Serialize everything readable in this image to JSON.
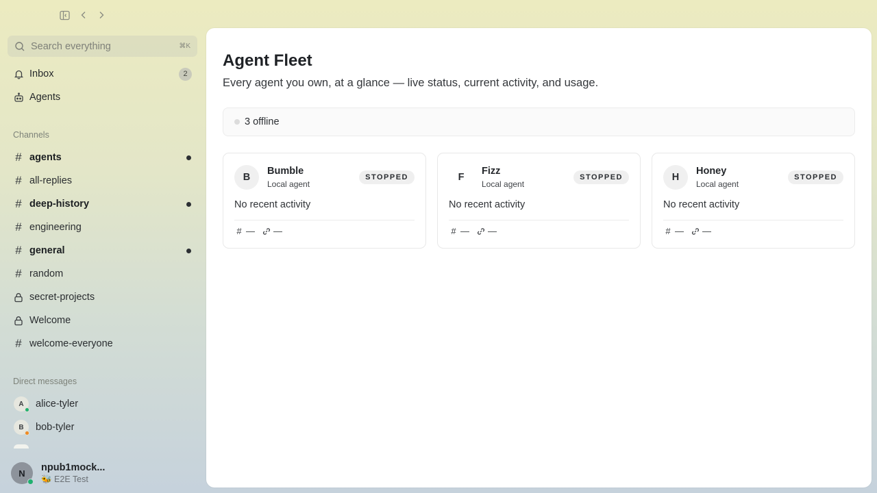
{
  "toolbar": {
    "icons": [
      "sidebar-toggle-icon",
      "back-arrow-icon",
      "forward-arrow-icon"
    ]
  },
  "sidebar": {
    "search": {
      "placeholder": "Search everything",
      "shortcut": "⌘K"
    },
    "nav": [
      {
        "label": "Inbox",
        "icon": "bell-icon",
        "badge": "2"
      },
      {
        "label": "Agents",
        "icon": "robot-icon"
      }
    ],
    "channels_label": "Channels",
    "channels": [
      {
        "label": "agents",
        "icon": "hash-icon",
        "unread": true
      },
      {
        "label": "all-replies",
        "icon": "hash-icon",
        "unread": false
      },
      {
        "label": "deep-history",
        "icon": "hash-icon",
        "unread": true
      },
      {
        "label": "engineering",
        "icon": "hash-icon",
        "unread": false
      },
      {
        "label": "general",
        "icon": "hash-icon",
        "unread": true
      },
      {
        "label": "random",
        "icon": "hash-icon",
        "unread": false
      },
      {
        "label": "secret-projects",
        "icon": "lock-icon",
        "unread": false
      },
      {
        "label": "Welcome",
        "icon": "lock-icon",
        "unread": false
      },
      {
        "label": "welcome-everyone",
        "icon": "hash-icon",
        "unread": false
      }
    ],
    "dm_label": "Direct messages",
    "dms": [
      {
        "label": "alice-tyler",
        "initial": "A",
        "presence_color": "#1fb06f"
      },
      {
        "label": "bob-tyler",
        "initial": "B",
        "presence_color": "#f08a24"
      }
    ],
    "user": {
      "name": "npub1mock...",
      "initial": "N",
      "status": "🐝 E2E Test"
    }
  },
  "main": {
    "title": "Agent Fleet",
    "subtitle": "Every agent you own, at a glance — live status, current activity, and usage.",
    "status_summary": "3 offline",
    "agents": [
      {
        "initial": "B",
        "name": "Bumble",
        "kind": "Local agent",
        "status": "STOPPED",
        "activity": "No recent activity",
        "channels": "—",
        "links": "—"
      },
      {
        "initial": "F",
        "name": "Fizz",
        "kind": "Local agent",
        "status": "STOPPED",
        "activity": "No recent activity",
        "channels": "—",
        "links": "—"
      },
      {
        "initial": "H",
        "name": "Honey",
        "kind": "Local agent",
        "status": "STOPPED",
        "activity": "No recent activity",
        "channels": "—",
        "links": "—"
      }
    ]
  }
}
